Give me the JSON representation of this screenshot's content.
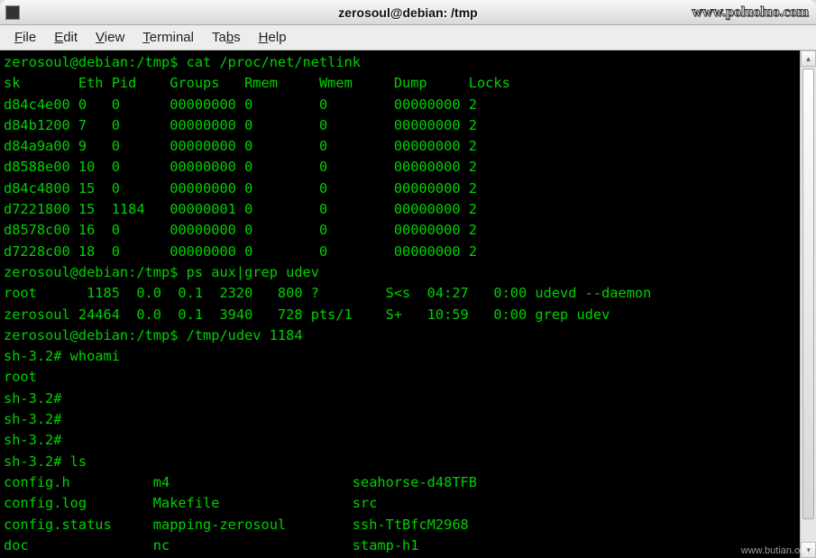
{
  "titlebar": {
    "title": "zerosoul@debian: /tmp",
    "watermark": "www.poluoluo.com"
  },
  "menubar": {
    "items": [
      {
        "label": "File",
        "ul_index": 0
      },
      {
        "label": "Edit",
        "ul_index": 0
      },
      {
        "label": "View",
        "ul_index": 0
      },
      {
        "label": "Terminal",
        "ul_index": 0
      },
      {
        "label": "Tabs",
        "ul_index": 2
      },
      {
        "label": "Help",
        "ul_index": 0
      }
    ]
  },
  "terminal": {
    "prompt1": "zerosoul@debian:/tmp$ ",
    "cmd1": "cat /proc/net/netlink",
    "netlink_header": "sk       Eth Pid    Groups   Rmem     Wmem     Dump     Locks",
    "netlink_rows": [
      {
        "sk": "d84c4e00",
        "eth": "0",
        "pid": "0",
        "groups": "00000000",
        "rmem": "0",
        "wmem": "0",
        "dump": "00000000",
        "locks": "2"
      },
      {
        "sk": "d84b1200",
        "eth": "7",
        "pid": "0",
        "groups": "00000000",
        "rmem": "0",
        "wmem": "0",
        "dump": "00000000",
        "locks": "2"
      },
      {
        "sk": "d84a9a00",
        "eth": "9",
        "pid": "0",
        "groups": "00000000",
        "rmem": "0",
        "wmem": "0",
        "dump": "00000000",
        "locks": "2"
      },
      {
        "sk": "d8588e00",
        "eth": "10",
        "pid": "0",
        "groups": "00000000",
        "rmem": "0",
        "wmem": "0",
        "dump": "00000000",
        "locks": "2"
      },
      {
        "sk": "d84c4800",
        "eth": "15",
        "pid": "0",
        "groups": "00000000",
        "rmem": "0",
        "wmem": "0",
        "dump": "00000000",
        "locks": "2"
      },
      {
        "sk": "d7221800",
        "eth": "15",
        "pid": "1184",
        "groups": "00000001",
        "rmem": "0",
        "wmem": "0",
        "dump": "00000000",
        "locks": "2"
      },
      {
        "sk": "d8578c00",
        "eth": "16",
        "pid": "0",
        "groups": "00000000",
        "rmem": "0",
        "wmem": "0",
        "dump": "00000000",
        "locks": "2"
      },
      {
        "sk": "d7228c00",
        "eth": "18",
        "pid": "0",
        "groups": "00000000",
        "rmem": "0",
        "wmem": "0",
        "dump": "00000000",
        "locks": "2"
      }
    ],
    "prompt2": "zerosoul@debian:/tmp$ ",
    "cmd2": "ps aux|grep udev",
    "ps_rows": [
      {
        "user": "root",
        "pid": "1185",
        "cpu": "0.0",
        "mem": "0.1",
        "vsz": "2320",
        "rss": "800",
        "tty": "?",
        "stat": "S<s",
        "start": "04:27",
        "time": "0:00",
        "cmd": "udevd --daemon"
      },
      {
        "user": "zerosoul",
        "pid": "24464",
        "cpu": "0.0",
        "mem": "0.1",
        "vsz": "3940",
        "rss": "728",
        "tty": "pts/1",
        "stat": "S+",
        "start": "10:59",
        "time": "0:00",
        "cmd": "grep udev"
      }
    ],
    "prompt3": "zerosoul@debian:/tmp$ ",
    "cmd3": "/tmp/udev 1184",
    "sh_prompt": "sh-3.2# ",
    "whoami_cmd": "whoami",
    "whoami_out": "root",
    "ls_cmd": "ls",
    "ls_rows": [
      [
        "config.h",
        "m4",
        "seahorse-d48TFB"
      ],
      [
        "config.log",
        "Makefile",
        "src"
      ],
      [
        "config.status",
        "mapping-zerosoul",
        "ssh-TtBfcM2968"
      ],
      [
        "doc",
        "nc",
        "stamp-h1"
      ]
    ]
  },
  "bottom_watermark": "www.butian.org"
}
